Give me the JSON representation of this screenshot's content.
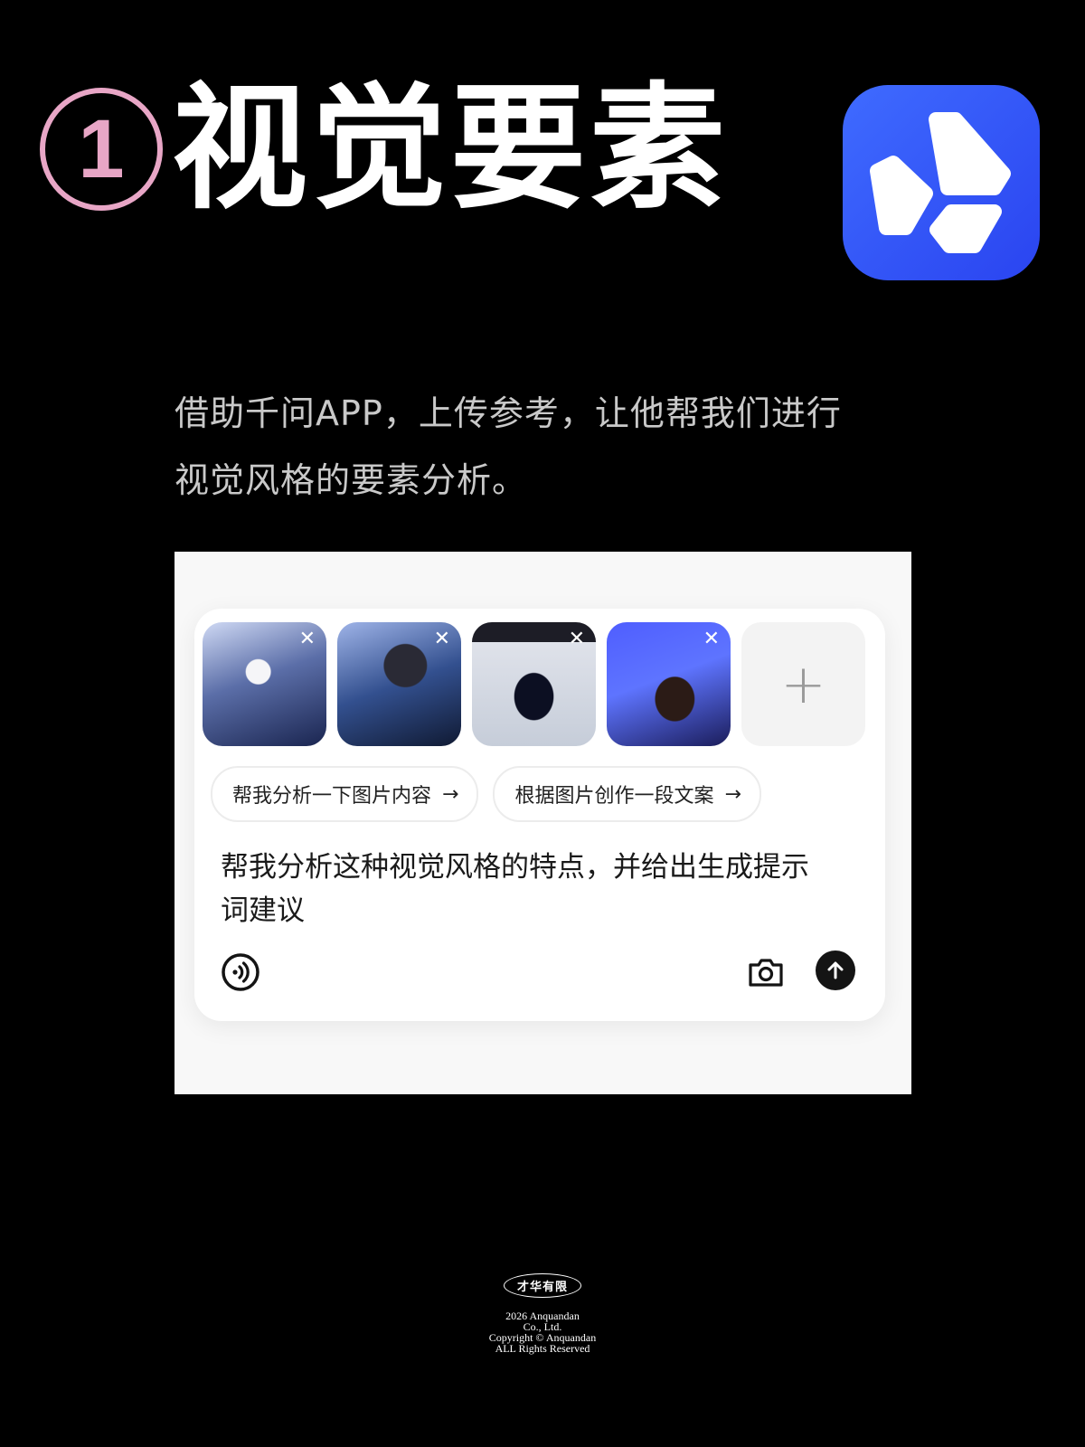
{
  "header": {
    "step_number": "1",
    "title": "视觉要素"
  },
  "app_logo": {
    "icon": "qwen-app-logo-icon",
    "bg_color": "#3358f5"
  },
  "intro": {
    "line1": "借助千问APP，上传参考，让他帮我们进行",
    "line2": "视觉风格的要素分析。"
  },
  "composer": {
    "images": [
      {
        "icon": "reference-image-1",
        "close_icon": "close-icon"
      },
      {
        "icon": "reference-image-2",
        "close_icon": "close-icon"
      },
      {
        "icon": "reference-image-3",
        "close_icon": "close-icon"
      },
      {
        "icon": "reference-image-4",
        "close_icon": "close-icon"
      }
    ],
    "add_image_label": "+",
    "suggestions": [
      {
        "label": "帮我分析一下图片内容",
        "arrow": "→"
      },
      {
        "label": "根据图片创作一段文案",
        "arrow": "→"
      }
    ],
    "input_text_line1": "帮我分析这种视觉风格的特点，并给出生成提示",
    "input_text_line2": "词建议",
    "toolbar": {
      "voice_icon": "voice-icon",
      "camera_icon": "camera-icon",
      "send_icon": "send-arrow-icon"
    }
  },
  "footer": {
    "badge": "才华有限",
    "lines": [
      "2026 Anquandan",
      "Co., Ltd.",
      "Copyright © Anquandan",
      "ALL Rights Reserved"
    ]
  }
}
